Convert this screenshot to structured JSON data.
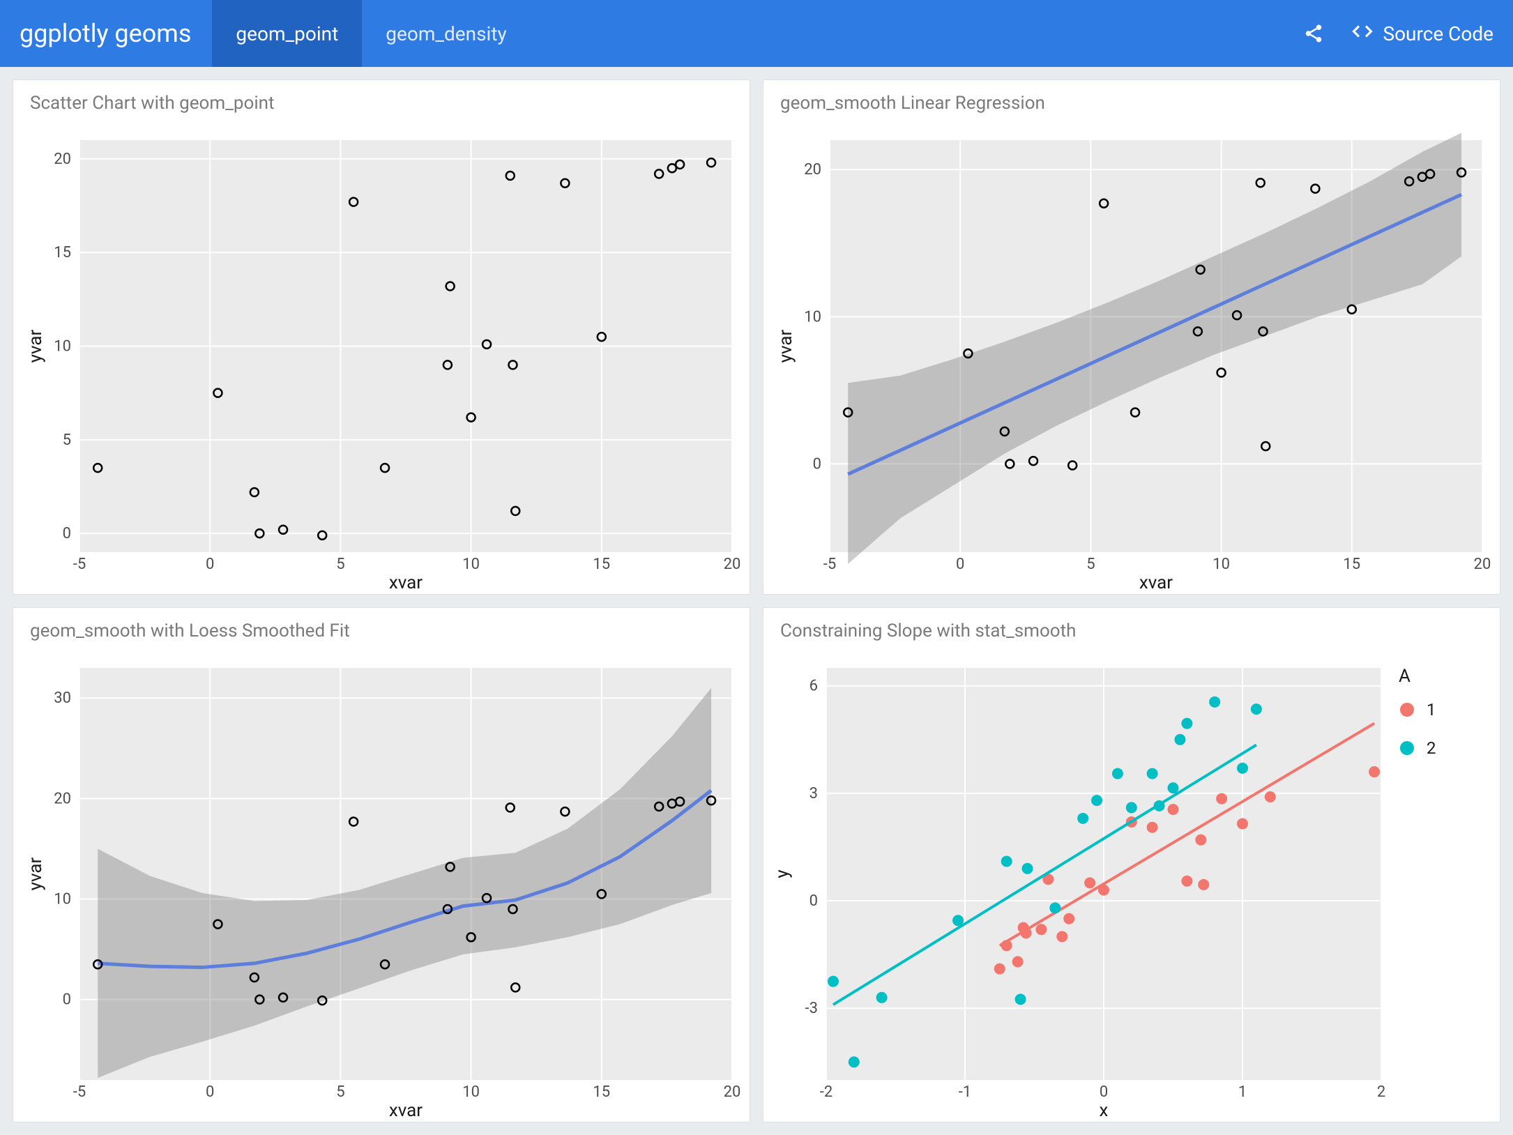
{
  "navbar": {
    "brand": "ggplotly geoms",
    "tabs": [
      {
        "label": "geom_point",
        "active": true
      },
      {
        "label": "geom_density",
        "active": false
      }
    ],
    "source_code": "Source Code"
  },
  "panels": {
    "p1": {
      "title": "Scatter Chart with geom_point",
      "xlabel": "xvar",
      "ylabel": "yvar"
    },
    "p2": {
      "title": "geom_smooth Linear Regression",
      "xlabel": "xvar",
      "ylabel": "yvar"
    },
    "p3": {
      "title": "geom_smooth with Loess Smoothed Fit",
      "xlabel": "xvar",
      "ylabel": "yvar"
    },
    "p4": {
      "title": "Constraining Slope with stat_smooth",
      "xlabel": "x",
      "ylabel": "y",
      "legend_title": "A",
      "legend_items": [
        "1",
        "2"
      ]
    }
  },
  "chart_data": [
    {
      "id": "p1",
      "type": "scatter",
      "title": "Scatter Chart with geom_point",
      "xlabel": "xvar",
      "ylabel": "yvar",
      "xlim": [
        -5,
        20
      ],
      "ylim": [
        -1,
        21
      ],
      "xticks": [
        -5,
        0,
        5,
        10,
        15,
        20
      ],
      "yticks": [
        0,
        5,
        10,
        15,
        20
      ],
      "x": [
        -4.3,
        0.3,
        1.7,
        1.9,
        2.8,
        4.3,
        5.5,
        6.7,
        9.1,
        9.2,
        10.0,
        10.6,
        11.5,
        11.6,
        11.7,
        13.6,
        15.0,
        17.2,
        17.7,
        18.0,
        19.2
      ],
      "y": [
        3.5,
        7.5,
        2.2,
        0.0,
        0.2,
        -0.1,
        17.7,
        3.5,
        9.0,
        13.2,
        6.2,
        10.1,
        19.1,
        9.0,
        1.2,
        18.7,
        10.5,
        19.2,
        19.5,
        19.7,
        19.8
      ]
    },
    {
      "id": "p2",
      "type": "scatter_with_lm",
      "title": "geom_smooth Linear Regression",
      "xlabel": "xvar",
      "ylabel": "yvar",
      "xlim": [
        -5,
        20
      ],
      "ylim": [
        -6,
        22
      ],
      "xticks": [
        -5,
        0,
        5,
        10,
        15,
        20
      ],
      "yticks": [
        0,
        10,
        20
      ],
      "x": [
        -4.3,
        0.3,
        1.7,
        1.9,
        2.8,
        4.3,
        5.5,
        6.7,
        9.1,
        9.2,
        10.0,
        10.6,
        11.5,
        11.6,
        11.7,
        13.6,
        15.0,
        17.2,
        17.7,
        18.0,
        19.2
      ],
      "y": [
        3.5,
        7.5,
        2.2,
        0.0,
        0.2,
        -0.1,
        17.7,
        3.5,
        9.0,
        13.2,
        6.2,
        10.1,
        19.1,
        9.0,
        1.2,
        18.7,
        10.5,
        19.2,
        19.5,
        19.7,
        19.8
      ],
      "fit": {
        "x": [
          -4.3,
          19.2
        ],
        "y": [
          -0.7,
          18.3
        ]
      },
      "ribbon_upper": [
        5.5,
        6.0,
        7.1,
        8.3,
        9.6,
        11.0,
        12.5,
        14.1,
        15.7,
        17.4,
        19.2,
        21.2,
        22.5
      ],
      "ribbon_lower": [
        -6.8,
        -3.7,
        -1.5,
        0.7,
        2.6,
        4.3,
        5.9,
        7.4,
        8.7,
        10.0,
        11.1,
        12.2,
        14.1
      ],
      "ribbon_x": [
        -4.3,
        -2.3,
        -0.3,
        1.7,
        3.7,
        5.7,
        7.7,
        9.7,
        11.7,
        13.7,
        15.7,
        17.7,
        19.2
      ]
    },
    {
      "id": "p3",
      "type": "scatter_with_loess",
      "title": "geom_smooth with Loess Smoothed Fit",
      "xlabel": "xvar",
      "ylabel": "yvar",
      "xlim": [
        -5,
        20
      ],
      "ylim": [
        -8,
        33
      ],
      "xticks": [
        -5,
        0,
        5,
        10,
        15,
        20
      ],
      "yticks": [
        0,
        10,
        20,
        30
      ],
      "x": [
        -4.3,
        0.3,
        1.7,
        1.9,
        2.8,
        4.3,
        5.5,
        6.7,
        9.1,
        9.2,
        10.0,
        10.6,
        11.5,
        11.6,
        11.7,
        13.6,
        15.0,
        17.2,
        17.7,
        18.0,
        19.2
      ],
      "y": [
        3.5,
        7.5,
        2.2,
        0.0,
        0.2,
        -0.1,
        17.7,
        3.5,
        9.0,
        13.2,
        6.2,
        10.1,
        19.1,
        9.0,
        1.2,
        18.7,
        10.5,
        19.2,
        19.5,
        19.7,
        19.8
      ],
      "fit_x": [
        -4.3,
        -2.3,
        -0.3,
        1.7,
        3.7,
        5.7,
        7.7,
        9.7,
        11.7,
        13.7,
        15.7,
        17.7,
        19.2
      ],
      "fit_y": [
        3.6,
        3.3,
        3.2,
        3.6,
        4.6,
        6.0,
        7.7,
        9.3,
        9.9,
        11.6,
        14.2,
        17.8,
        20.8
      ],
      "ribbon_upper": [
        15.0,
        12.3,
        10.6,
        9.8,
        9.9,
        10.9,
        12.5,
        14.1,
        14.6,
        17.0,
        20.9,
        26.2,
        31.0
      ],
      "ribbon_lower": [
        -7.8,
        -5.7,
        -4.2,
        -2.6,
        -0.7,
        1.1,
        2.9,
        4.5,
        5.2,
        6.2,
        7.5,
        9.4,
        10.6
      ]
    },
    {
      "id": "p4",
      "type": "scatter_grouped_lines",
      "title": "Constraining Slope with stat_smooth",
      "xlabel": "x",
      "ylabel": "y",
      "xlim": [
        -2,
        2
      ],
      "ylim": [
        -5,
        6.5
      ],
      "xticks": [
        -2,
        -1,
        0,
        1,
        2
      ],
      "yticks": [
        -3,
        0,
        3,
        6
      ],
      "series": [
        {
          "name": "1",
          "color": "#f2766d",
          "x": [
            -0.75,
            -0.7,
            -0.62,
            -0.58,
            -0.56,
            -0.45,
            -0.4,
            -0.3,
            -0.25,
            -0.1,
            0.0,
            0.2,
            0.35,
            0.5,
            0.6,
            0.7,
            0.72,
            0.85,
            1.0,
            1.2,
            1.95
          ],
          "y": [
            -1.9,
            -1.25,
            -1.7,
            -0.75,
            -0.9,
            -0.8,
            0.6,
            -1.0,
            -0.5,
            0.5,
            0.3,
            2.2,
            2.05,
            2.55,
            0.55,
            1.7,
            0.45,
            2.85,
            2.15,
            2.9,
            3.6
          ],
          "fit": {
            "x": [
              -0.75,
              1.95
            ],
            "y": [
              -1.25,
              4.95
            ]
          }
        },
        {
          "name": "2",
          "color": "#00bfc4",
          "x": [
            -1.95,
            -1.8,
            -1.6,
            -1.05,
            -0.7,
            -0.6,
            -0.55,
            -0.35,
            -0.15,
            -0.05,
            0.1,
            0.2,
            0.35,
            0.4,
            0.5,
            0.55,
            0.6,
            0.8,
            1.0,
            1.1
          ],
          "y": [
            -2.25,
            -4.5,
            -2.7,
            -0.55,
            1.1,
            -2.75,
            0.9,
            -0.2,
            2.3,
            2.8,
            3.55,
            2.6,
            3.55,
            2.65,
            3.15,
            4.5,
            4.95,
            5.55,
            3.7,
            5.35
          ],
          "fit": {
            "x": [
              -1.95,
              1.1
            ],
            "y": [
              -2.9,
              4.35
            ]
          }
        }
      ],
      "legend": {
        "title": "A",
        "items": [
          "1",
          "2"
        ]
      }
    }
  ]
}
